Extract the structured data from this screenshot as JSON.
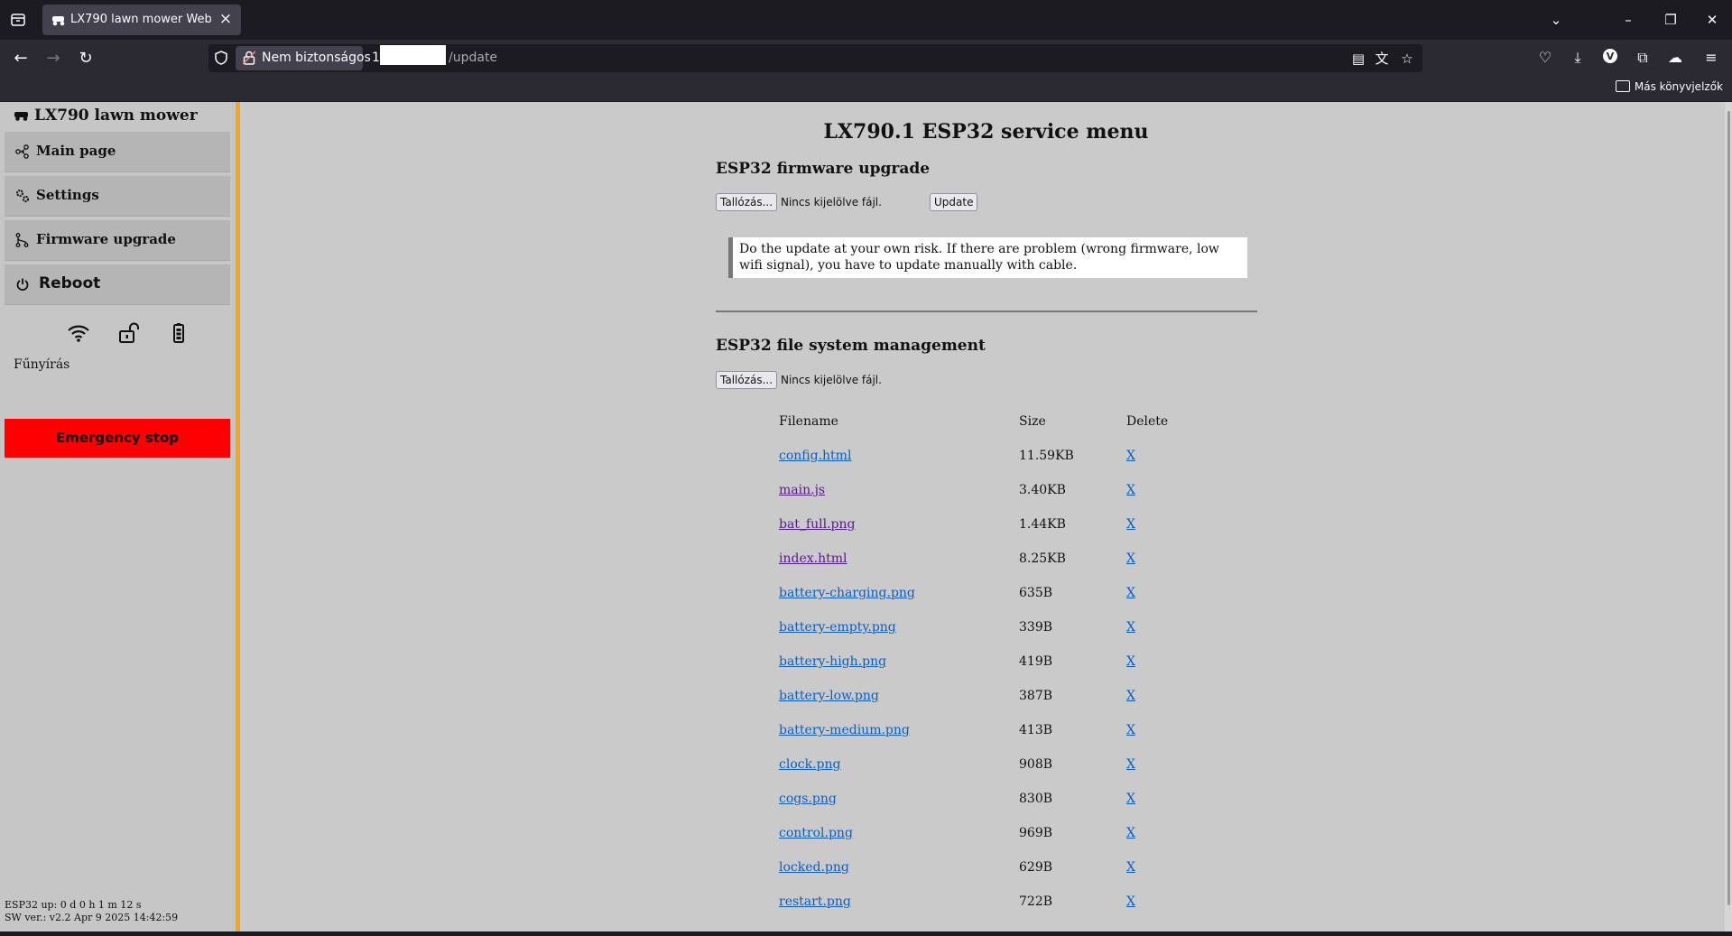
{
  "browser": {
    "tab_title": "LX790 lawn mower Web",
    "security_badge": "Nem biztonságos",
    "url_host": "1",
    "url_path": "/update",
    "bookmark_folder": "Más könyvjelzők"
  },
  "sidebar": {
    "brand": "LX790 lawn mower",
    "menu": [
      {
        "label": "Main page",
        "icon": "nodes-icon"
      },
      {
        "label": "Settings",
        "icon": "cogs-icon"
      },
      {
        "label": "Firmware upgrade",
        "icon": "branch-icon"
      },
      {
        "label": "Reboot",
        "icon": "power-icon"
      }
    ],
    "status_icons": [
      "wifi-icon",
      "unlocked-icon",
      "battery-icon"
    ],
    "mode": "Fűnyírás",
    "emergency_stop": "Emergency stop",
    "uptime": "ESP32 up: 0 d 0 h 1 m 12 s",
    "sw_version": "SW ver.: v2.2 Apr 9 2025 14:42:59"
  },
  "main": {
    "title": "LX790.1 ESP32 service menu",
    "firmware": {
      "heading": "ESP32 firmware upgrade",
      "browse_label": "Tallózás...",
      "no_file": "Nincs kijelölve fájl.",
      "update_label": "Update",
      "notice": "Do the update at your own risk. If there are problem (wrong firmware, low wifi signal), you have to update manually with cable."
    },
    "filesystem": {
      "heading": "ESP32 file system management",
      "browse_label": "Tallózás...",
      "no_file": "Nincs kijelölve fájl.",
      "columns": [
        "Filename",
        "Size",
        "Delete"
      ],
      "delete_label": "X",
      "files": [
        {
          "name": "config.html",
          "size": "11.59KB",
          "visited": false
        },
        {
          "name": "main.js",
          "size": "3.40KB",
          "visited": true
        },
        {
          "name": "bat_full.png",
          "size": "1.44KB",
          "visited": true
        },
        {
          "name": "index.html",
          "size": "8.25KB",
          "visited": true
        },
        {
          "name": "battery-charging.png",
          "size": "635B",
          "visited": false
        },
        {
          "name": "battery-empty.png",
          "size": "339B",
          "visited": false
        },
        {
          "name": "battery-high.png",
          "size": "419B",
          "visited": false
        },
        {
          "name": "battery-low.png",
          "size": "387B",
          "visited": false
        },
        {
          "name": "battery-medium.png",
          "size": "413B",
          "visited": false
        },
        {
          "name": "clock.png",
          "size": "908B",
          "visited": false
        },
        {
          "name": "cogs.png",
          "size": "830B",
          "visited": false
        },
        {
          "name": "control.png",
          "size": "969B",
          "visited": false
        },
        {
          "name": "locked.png",
          "size": "629B",
          "visited": false
        },
        {
          "name": "restart.png",
          "size": "722B",
          "visited": false
        }
      ]
    }
  },
  "colors": {
    "accent_bar": "#f6a51c",
    "emergency": "#ff0000",
    "link": "#0b5ec5",
    "link_visited": "#551a8b"
  }
}
